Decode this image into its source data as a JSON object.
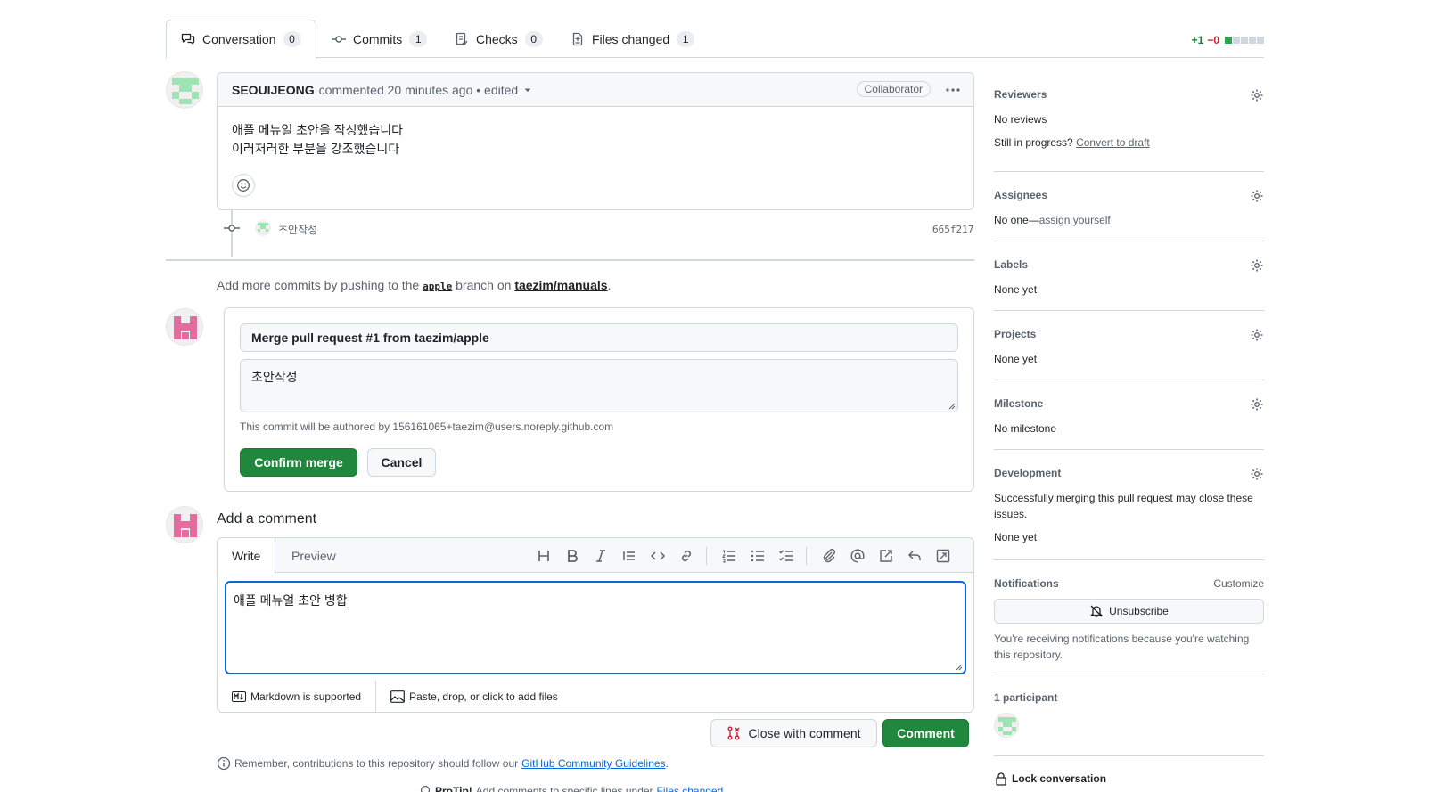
{
  "tabs": [
    {
      "label": "Conversation",
      "count": "0"
    },
    {
      "label": "Commits",
      "count": "1"
    },
    {
      "label": "Checks",
      "count": "0"
    },
    {
      "label": "Files changed",
      "count": "1"
    }
  ],
  "diffstat": {
    "additions": "+1",
    "deletions": "−0"
  },
  "comment": {
    "author": "SEOUIJEONG",
    "meta": "commented 20 minutes ago • edited",
    "badge": "Collaborator",
    "line1": "애플 메뉴얼 초안을 작성했습니다",
    "line2": "이러저러한 부분을 강조했습니다"
  },
  "commit": {
    "message": "초안작성",
    "sha": "665f217"
  },
  "push_hint": {
    "prefix": "Add more commits by pushing to the",
    "branch": "apple",
    "middle": "branch on",
    "repo": "taezim/manuals",
    "suffix": "."
  },
  "merge": {
    "title_value": "Merge pull request #1 from taezim/apple",
    "body_value": "초안작성",
    "author_note": "This commit will be authored by 156161065+taezim@users.noreply.github.com",
    "confirm_label": "Confirm merge",
    "cancel_label": "Cancel"
  },
  "add_comment": {
    "heading": "Add a comment",
    "write_tab": "Write",
    "preview_tab": "Preview",
    "text_value": "애플 메뉴얼 초안 병합",
    "markdown_note": "Markdown is supported",
    "attach_note": "Paste, drop, or click to add files",
    "close_label": "Close with comment",
    "comment_label": "Comment",
    "guidelines_prefix": "Remember, contributions to this repository should follow our",
    "guidelines_link": "GitHub Community Guidelines",
    "guidelines_suffix": ".",
    "protip_prefix": "ProTip!",
    "protip_text": "Add comments to specific lines under",
    "protip_link": "Files changed"
  },
  "sidebar": {
    "reviewers": {
      "title": "Reviewers",
      "value": "No reviews",
      "progress": "Still in progress?",
      "draft_link": "Convert to draft"
    },
    "assignees": {
      "title": "Assignees",
      "value": "No one—",
      "link": "assign yourself"
    },
    "labels": {
      "title": "Labels",
      "value": "None yet"
    },
    "projects": {
      "title": "Projects",
      "value": "None yet"
    },
    "milestone": {
      "title": "Milestone",
      "value": "No milestone"
    },
    "development": {
      "title": "Development",
      "desc": "Successfully merging this pull request may close these issues.",
      "value": "None yet"
    },
    "notifications": {
      "title": "Notifications",
      "customize": "Customize",
      "unsubscribe": "Unsubscribe",
      "desc": "You're receiving notifications because you're watching this repository."
    },
    "participants": {
      "title": "1 participant"
    },
    "lock": {
      "label": "Lock conversation"
    }
  },
  "colors": {
    "green": "#1f883d",
    "blue_focus": "#0969da",
    "border": "#d0d7de"
  }
}
